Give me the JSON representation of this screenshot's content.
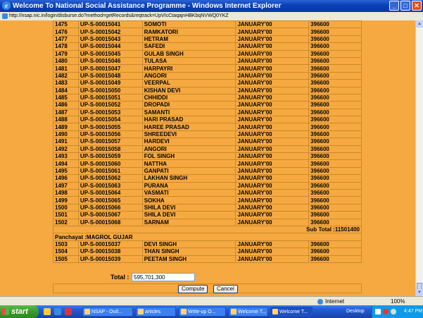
{
  "window": {
    "title": "Welcome To National Social Assistance Programme - Windows Internet Explorer",
    "url": "http://nsap.nic.in/login/disburse.do?method=getRecords&reqtrack=UpVIcCtaqajnHBKbqNVWQ0YKZ"
  },
  "rows_a": [
    [
      "1475",
      "UP-S-00015041",
      "SOMOTI",
      "JANUARY'00",
      "396600"
    ],
    [
      "1476",
      "UP-S-00015042",
      "RAMKATORI",
      "JANUARY'00",
      "396600"
    ],
    [
      "1477",
      "UP-S-00015043",
      "HETRAM",
      "JANUARY'00",
      "396600"
    ],
    [
      "1478",
      "UP-S-00015044",
      "SAFEDI",
      "JANUARY'00",
      "396600"
    ],
    [
      "1479",
      "UP-S-00015045",
      "GULAB SINGH",
      "JANUARY'00",
      "396600"
    ],
    [
      "1480",
      "UP-S-00015046",
      "TULASA",
      "JANUARY'00",
      "396600"
    ],
    [
      "1481",
      "UP-S-00015047",
      "HARPAYRI",
      "JANUARY'00",
      "396600"
    ],
    [
      "1482",
      "UP-S-00015048",
      "ANGORI",
      "JANUARY'00",
      "396600"
    ],
    [
      "1483",
      "UP-S-00015049",
      "VEERPAL",
      "JANUARY'00",
      "396600"
    ],
    [
      "1484",
      "UP-S-00015050",
      "KISHAN DEVI",
      "JANUARY'00",
      "396600"
    ],
    [
      "1485",
      "UP-S-00015051",
      "CHHIDDI",
      "JANUARY'00",
      "396600"
    ],
    [
      "1486",
      "UP-S-00015052",
      "DROPADI",
      "JANUARY'00",
      "396600"
    ],
    [
      "1487",
      "UP-S-00015053",
      "SAMANTI",
      "JANUARY'00",
      "396600"
    ],
    [
      "1488",
      "UP-S-00015054",
      "HARI PRASAD",
      "JANUARY'00",
      "396600"
    ],
    [
      "1489",
      "UP-S-00015055",
      "HAREE PRASAD",
      "JANUARY'00",
      "396600"
    ],
    [
      "1490",
      "UP-S-00015056",
      "SHREEDEVI",
      "JANUARY'00",
      "396600"
    ],
    [
      "1491",
      "UP-S-00015057",
      "HARDEVI",
      "JANUARY'00",
      "396600"
    ],
    [
      "1492",
      "UP-S-00015058",
      "ANGORI",
      "JANUARY'00",
      "396600"
    ],
    [
      "1493",
      "UP-S-00015059",
      "FOL SINGH",
      "JANUARY'00",
      "396600"
    ],
    [
      "1494",
      "UP-S-00015060",
      "NATTHA",
      "JANUARY'00",
      "396600"
    ],
    [
      "1495",
      "UP-S-00015061",
      "GANPATI",
      "JANUARY'00",
      "396600"
    ],
    [
      "1496",
      "UP-S-00015062",
      "LAKHAN SINGH",
      "JANUARY'00",
      "396600"
    ],
    [
      "1497",
      "UP-S-00015063",
      "PURANA",
      "JANUARY'00",
      "396600"
    ],
    [
      "1498",
      "UP-S-00015064",
      "VASMATI",
      "JANUARY'00",
      "396600"
    ],
    [
      "1499",
      "UP-S-00015065",
      "SOKHA",
      "JANUARY'00",
      "396600"
    ],
    [
      "1500",
      "UP-S-00015066",
      "SHILA DEVI",
      "JANUARY'00",
      "396600"
    ],
    [
      "1501",
      "UP-S-00015067",
      "SHILA DEVI",
      "JANUARY'00",
      "396600"
    ],
    [
      "1502",
      "UP-S-00015068",
      "SARNAM",
      "JANUARY'00",
      "396600"
    ]
  ],
  "subtotal": "Sub Total :11501400",
  "panchayat": "Panchayat :MAGROL GUJAR",
  "rows_b": [
    [
      "1503",
      "UP-S-00015037",
      "DEVI SINGH",
      "JANUARY'00",
      "396600"
    ],
    [
      "1504",
      "UP-S-00015038",
      "THAN SINGH",
      "JANUARY'00",
      "396600"
    ],
    [
      "1505",
      "UP-S-00015039",
      "PEETAM SINGH",
      "JANUARY'00",
      "396600"
    ]
  ],
  "total": {
    "label": "Total :",
    "value": "595,701,300"
  },
  "buttons": {
    "compute": "Compute",
    "cancel": "Cancel"
  },
  "status": {
    "zone": "Internet",
    "zoom": "100%"
  },
  "taskbar": {
    "start": "start",
    "tasks": [
      "NSAP - Outl...",
      "articles",
      "Write-up O...",
      "Welcome T...",
      "Welcome T..."
    ],
    "desktop": "Desktop",
    "clock": "4:47 PM"
  }
}
